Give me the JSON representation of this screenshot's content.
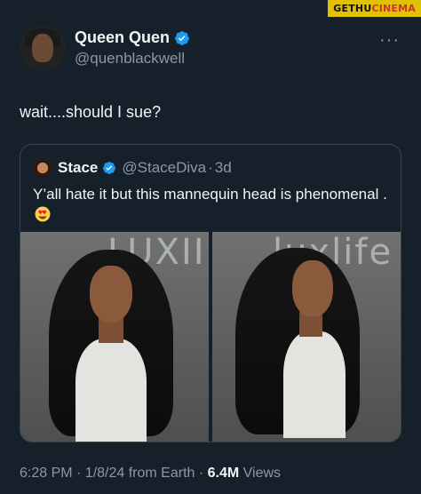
{
  "watermark": {
    "part1": "GETHU",
    "part2": "CINEMA"
  },
  "tweet": {
    "display_name": "Queen Quen",
    "handle": "@quenblackwell",
    "text": "wait....should I sue?"
  },
  "quote": {
    "display_name": "Stace",
    "handle": "@StaceDiva",
    "separator": "·",
    "time": "3d",
    "text": "Y’all hate it but this mannequin head is phenomenal ."
  },
  "photos": [
    {
      "sign_text": "LUXII"
    },
    {
      "sign_text": "luxlife"
    }
  ],
  "meta": {
    "time": "6:28 PM · 1/8/24 from Earth · ",
    "views_count": "6.4M",
    "views_label": " Views"
  },
  "colors": {
    "background": "#15202b",
    "verified": "#1d9bf0",
    "muted": "#8b98a5"
  }
}
